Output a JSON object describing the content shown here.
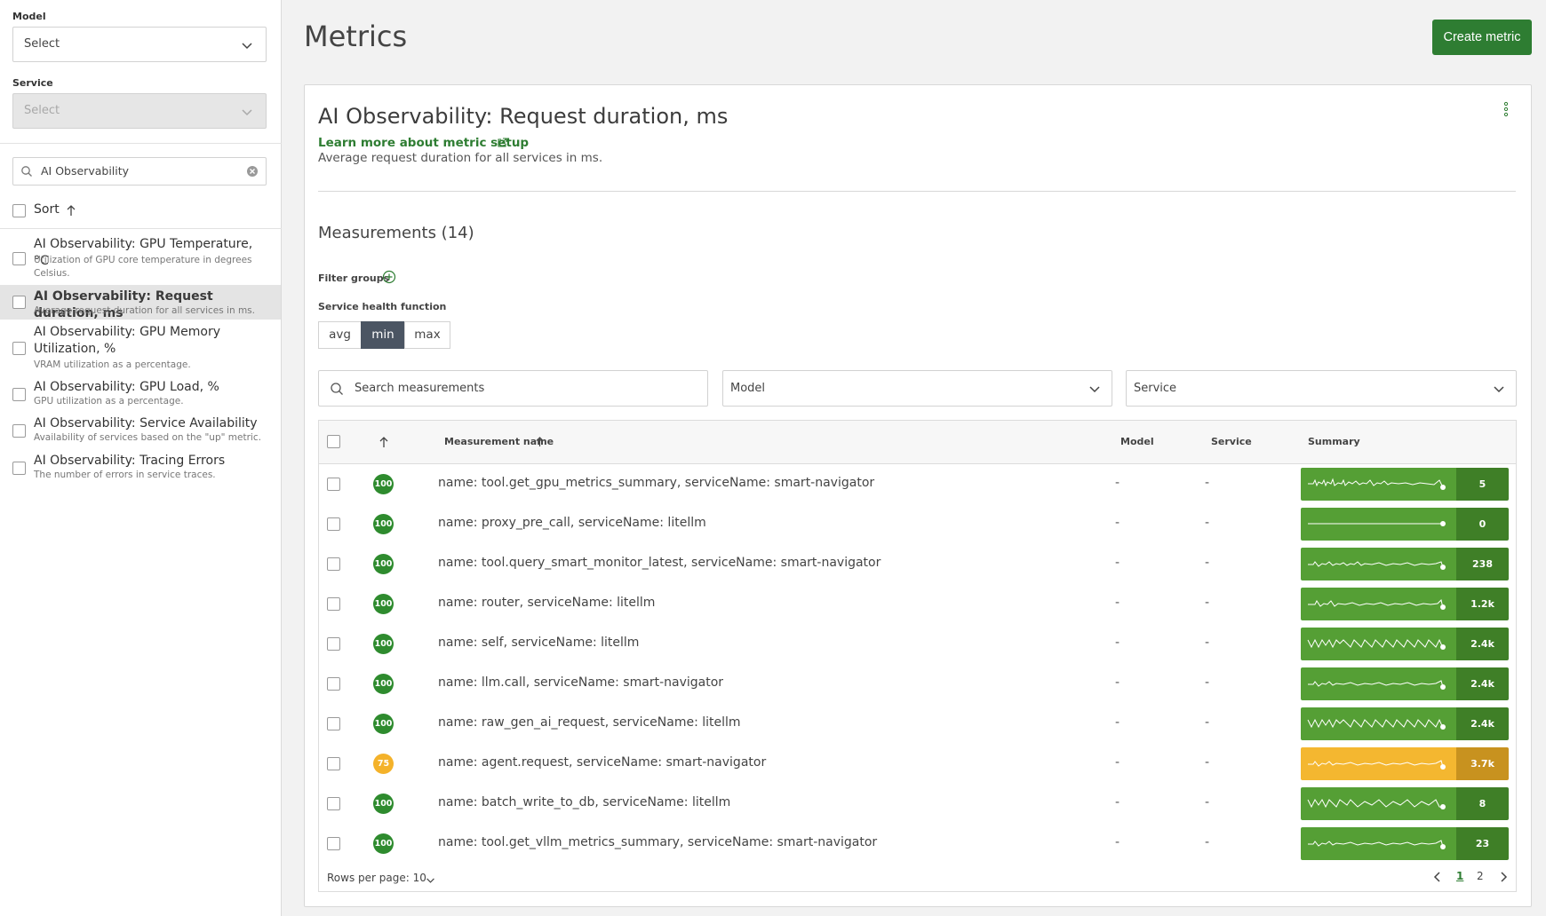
{
  "sidebar": {
    "model_label": "Model",
    "model_select": "Select",
    "service_label": "Service",
    "service_select": "Select",
    "search_value": "AI Observability",
    "sort_label": "Sort",
    "metrics": [
      {
        "title": "AI Observability: GPU Temperature, °C",
        "desc": "Utilization of GPU core temperature in degrees Celsius."
      },
      {
        "title": "AI Observability: Request duration, ms",
        "desc": "Average request duration for all services in ms."
      },
      {
        "title": "AI Observability: GPU Memory Utilization, %",
        "desc": "VRAM utilization as a percentage."
      },
      {
        "title": "AI Observability: GPU Load, %",
        "desc": "GPU utilization as a percentage."
      },
      {
        "title": "AI Observability: Service Availability",
        "desc": "Availability of services based on the \"up\" metric."
      },
      {
        "title": "AI Observability: Tracing Errors",
        "desc": "The number of errors in service traces."
      }
    ]
  },
  "header": {
    "title": "Metrics",
    "create_button": "Create metric"
  },
  "card": {
    "title": "AI Observability: Request duration, ms",
    "learn_link": "Learn more about metric setup",
    "description": "Average request duration for all services in ms.",
    "measurements_title": "Measurements (14)",
    "filter_groups_label": "Filter groups",
    "health_function_label": "Service health function",
    "health_options": [
      "avg",
      "min",
      "max"
    ],
    "health_selected": "min",
    "search_placeholder": "Search measurements",
    "model_filter": "Model",
    "service_filter": "Service"
  },
  "table": {
    "headers": {
      "name": "Measurement name",
      "model": "Model",
      "service": "Service",
      "summary": "Summary"
    },
    "rows": [
      {
        "score": "100",
        "status": "ok",
        "name": "name: tool.get_gpu_metrics_summary, serviceName: smart-navigator",
        "model": "-",
        "service": "-",
        "summary": "5"
      },
      {
        "score": "100",
        "status": "ok",
        "name": "name: proxy_pre_call, serviceName: litellm",
        "model": "-",
        "service": "-",
        "summary": "0"
      },
      {
        "score": "100",
        "status": "ok",
        "name": "name: tool.query_smart_monitor_latest, serviceName: smart-navigator",
        "model": "-",
        "service": "-",
        "summary": "238"
      },
      {
        "score": "100",
        "status": "ok",
        "name": "name: router, serviceName: litellm",
        "model": "-",
        "service": "-",
        "summary": "1.2k"
      },
      {
        "score": "100",
        "status": "ok",
        "name": "name: self, serviceName: litellm",
        "model": "-",
        "service": "-",
        "summary": "2.4k"
      },
      {
        "score": "100",
        "status": "ok",
        "name": "name: llm.call, serviceName: smart-navigator",
        "model": "-",
        "service": "-",
        "summary": "2.4k"
      },
      {
        "score": "100",
        "status": "ok",
        "name": "name: raw_gen_ai_request, serviceName: litellm",
        "model": "-",
        "service": "-",
        "summary": "2.4k"
      },
      {
        "score": "75",
        "status": "warn",
        "name": "name: agent.request, serviceName: smart-navigator",
        "model": "-",
        "service": "-",
        "summary": "3.7k"
      },
      {
        "score": "100",
        "status": "ok",
        "name": "name: batch_write_to_db, serviceName: litellm",
        "model": "-",
        "service": "-",
        "summary": "8"
      },
      {
        "score": "100",
        "status": "ok",
        "name": "name: tool.get_vllm_metrics_summary, serviceName: smart-navigator",
        "model": "-",
        "service": "-",
        "summary": "23"
      }
    ],
    "rows_per_page_label": "Rows per page: 10",
    "pages": [
      "1",
      "2"
    ],
    "current_page": "1"
  },
  "colors": {
    "accent": "#2e7d32",
    "ok": "#559f35",
    "warn": "#f4b730"
  }
}
